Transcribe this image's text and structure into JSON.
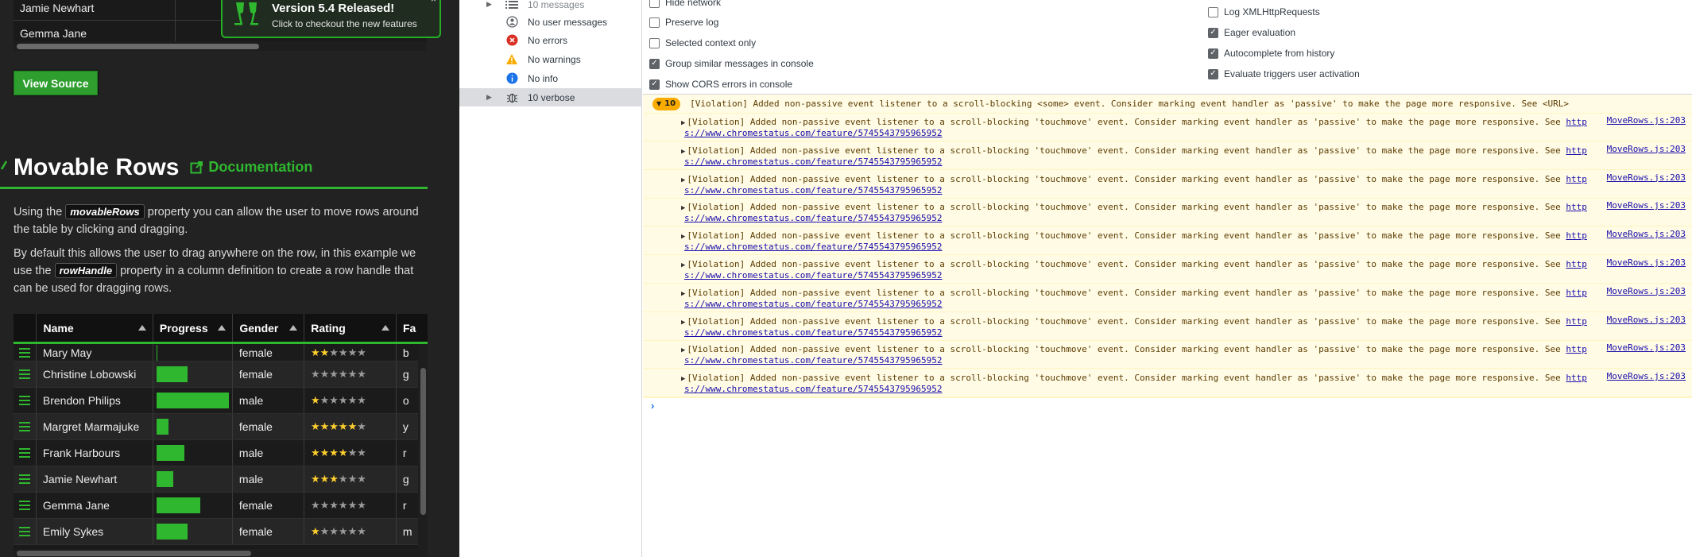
{
  "colors": {
    "accent_green": "#2fb82f",
    "star_on": "#ffcf2e",
    "warning": "#f9ab00"
  },
  "page": {
    "top_table_rows": [
      "Jamie Newhart",
      "Gemma Jane"
    ],
    "popup": {
      "title": "Version 5.4 Released!",
      "subtitle": "Click to checkout the new features",
      "icon": "cheers-icon"
    },
    "view_source_label": "View Source",
    "section": {
      "title": "Movable Rows",
      "doc_link": "Documentation"
    },
    "para1": {
      "before": "Using the",
      "code": "movableRows",
      "after": "property you can allow the user to move rows around the table by clicking and dragging."
    },
    "para2": {
      "before": "By default this allows the user to drag anywhere on the row, in this example we use the",
      "code": "rowHandle",
      "after": "property in a column definition to create a row handle that can be used for dragging rows."
    },
    "table": {
      "columns": [
        "Name",
        "Progress",
        "Gender",
        "Rating",
        "Fa"
      ],
      "rows": [
        {
          "name": "Mary May",
          "progress": 1,
          "gender": "female",
          "rating": 2,
          "fav": "b"
        },
        {
          "name": "Christine Lobowski",
          "progress": 42,
          "gender": "female",
          "rating": 0,
          "fav": "g"
        },
        {
          "name": "Brendon Philips",
          "progress": 100,
          "gender": "male",
          "rating": 1,
          "fav": "o"
        },
        {
          "name": "Margret Marmajuke",
          "progress": 16,
          "gender": "female",
          "rating": 5,
          "fav": "y"
        },
        {
          "name": "Frank Harbours",
          "progress": 38,
          "gender": "male",
          "rating": 4,
          "fav": "r"
        },
        {
          "name": "Jamie Newhart",
          "progress": 23,
          "gender": "male",
          "rating": 3,
          "fav": "g"
        },
        {
          "name": "Gemma Jane",
          "progress": 60,
          "gender": "female",
          "rating": 0,
          "fav": "r"
        },
        {
          "name": "Emily Sykes",
          "progress": 42,
          "gender": "female",
          "rating": 1,
          "fav": "m"
        }
      ]
    }
  },
  "devtools": {
    "sidebar": [
      {
        "label": "10 messages",
        "icon": "list-icon"
      },
      {
        "label": "No user messages",
        "icon": "user-icon"
      },
      {
        "label": "No errors",
        "icon": "error-icon"
      },
      {
        "label": "No warnings",
        "icon": "warning-icon"
      },
      {
        "label": "No info",
        "icon": "info-icon"
      },
      {
        "label": "10 verbose",
        "icon": "bug-icon"
      }
    ],
    "settings_left": [
      {
        "label": "Hide network",
        "checked": false
      },
      {
        "label": "Preserve log",
        "checked": false
      },
      {
        "label": "Selected context only",
        "checked": false
      },
      {
        "label": "Group similar messages in console",
        "checked": true
      },
      {
        "label": "Show CORS errors in console",
        "checked": true
      }
    ],
    "settings_right": [
      {
        "label": "Log XMLHttpRequests",
        "checked": false
      },
      {
        "label": "Eager evaluation",
        "checked": true
      },
      {
        "label": "Autocomplete from history",
        "checked": true
      },
      {
        "label": "Evaluate triggers user activation",
        "checked": true
      }
    ],
    "violation_group": {
      "count": "10",
      "message": "[Violation] Added non-passive event listener to a scroll-blocking <some> event. Consider marking event handler as 'passive' to make the page more responsive. See <URL>"
    },
    "violation_entry": {
      "text": "[Violation] Added non-passive event listener to a scroll-blocking 'touchmove' event. Consider marking event handler as 'passive' to make the page more responsive. See",
      "link_start": "http",
      "link_cont": "s://www.chromestatus.com/feature/5745543795965952",
      "source": "MoveRows.js:203",
      "count": 10
    },
    "prompt_symbol": "›"
  }
}
